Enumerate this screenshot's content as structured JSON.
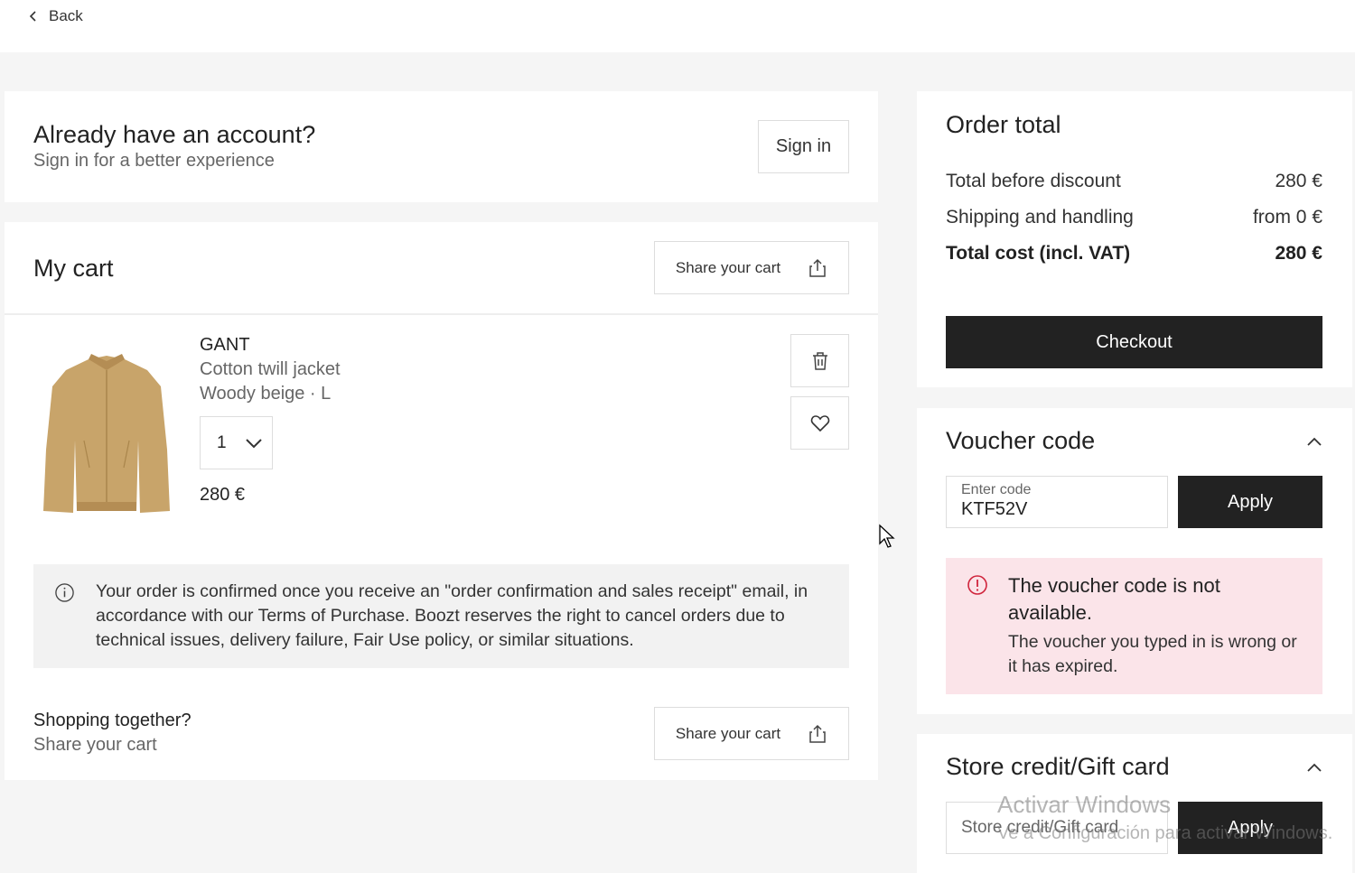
{
  "topbar": {
    "back_label": "Back"
  },
  "account": {
    "title": "Already have an account?",
    "subtitle": "Sign in for a better experience",
    "sign_in_label": "Sign in"
  },
  "cart": {
    "title": "My cart",
    "share_label": "Share your cart",
    "item": {
      "brand": "GANT",
      "name": "Cotton twill jacket",
      "variant": "Woody beige · L",
      "quantity": "1",
      "price": "280 €"
    },
    "notice": "Your order is confirmed once you receive an \"order confirmation and sales receipt\" email, in accordance with our Terms of Purchase. Boozt reserves the right to cancel orders due to technical issues, delivery failure, Fair Use policy, or similar situations.",
    "together_title": "Shopping together?",
    "together_subtitle": "Share your cart",
    "together_share_label": "Share your cart"
  },
  "order": {
    "title": "Order total",
    "rows": [
      {
        "label": "Total before discount",
        "value": "280 €"
      },
      {
        "label": "Shipping and handling",
        "value": "from 0 €"
      },
      {
        "label": "Total cost (incl. VAT)",
        "value": "280 €"
      }
    ],
    "checkout_label": "Checkout"
  },
  "voucher": {
    "title": "Voucher code",
    "field_label": "Enter code",
    "field_value": "KTF52V",
    "apply_label": "Apply",
    "error_title": "The voucher code is not available.",
    "error_detail": "The voucher you typed in is wrong or it has expired."
  },
  "gift": {
    "title": "Store credit/Gift card",
    "placeholder": "Store credit/Gift card",
    "apply_label": "Apply"
  },
  "watermark": {
    "line1": "Activar Windows",
    "line2": "Ve a Configuración para activar Windows."
  },
  "colors": {
    "dark_button": "#222222",
    "error_bg": "#fbe4e9",
    "error_icon": "#d0243c",
    "page_bg": "#f5f5f5"
  }
}
